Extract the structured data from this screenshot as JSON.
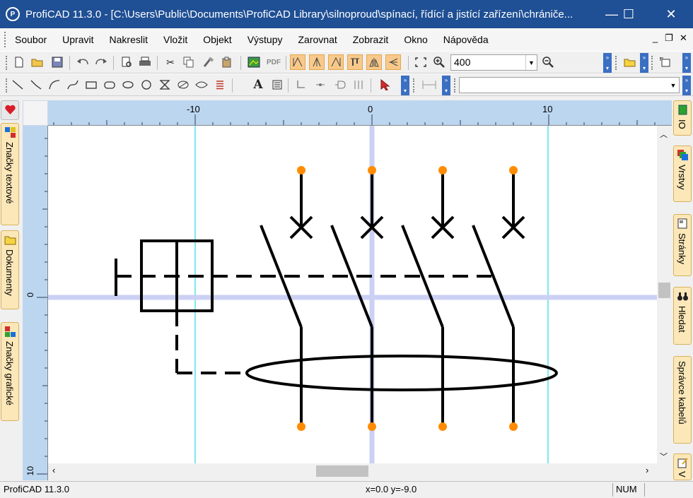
{
  "window": {
    "title": "ProfiCAD 11.3.0 - [C:\\Users\\Public\\Documents\\ProfiCAD Library\\silnoproud\\spínací, řídící a jistící zařízení\\chrániče...",
    "app_icon": "proficad-logo-icon",
    "minimize": "—",
    "maximize": "☐",
    "close": "✕"
  },
  "menu": {
    "items": [
      "Soubor",
      "Upravit",
      "Nakreslit",
      "Vložit",
      "Objekt",
      "Výstupy",
      "Zarovnat",
      "Zobrazit",
      "Okno",
      "Nápověda"
    ],
    "mdi_minimize": "_",
    "mdi_restore": "❐",
    "mdi_close": "✕"
  },
  "toolbar1": {
    "zoom_value": "400"
  },
  "toolbar2": {
    "text_tool": "A"
  },
  "left_panel": {
    "tabs": [
      "Značky textové",
      "Dokumenty",
      "Značky grafické"
    ]
  },
  "right_panel": {
    "tabs": [
      "IO",
      "Vrstvy",
      "Stránky",
      "Hledat",
      "Správce kabelů",
      "V"
    ]
  },
  "rulers": {
    "h_labels": [
      "-10",
      "0",
      "10"
    ],
    "v_labels": [
      "0",
      "10"
    ]
  },
  "status": {
    "app": "ProfiCAD 11.3.0",
    "coords": "x=0.0  y=-9.0",
    "num": "NUM"
  },
  "colors": {
    "titlebar": "#1f4f94",
    "ruler": "#bcd6f0",
    "tab": "#fbe7b8",
    "terminal": "#ff8c00",
    "guide_cyan": "#7ee8ec",
    "guide_lavender": "#cbd0f4"
  }
}
